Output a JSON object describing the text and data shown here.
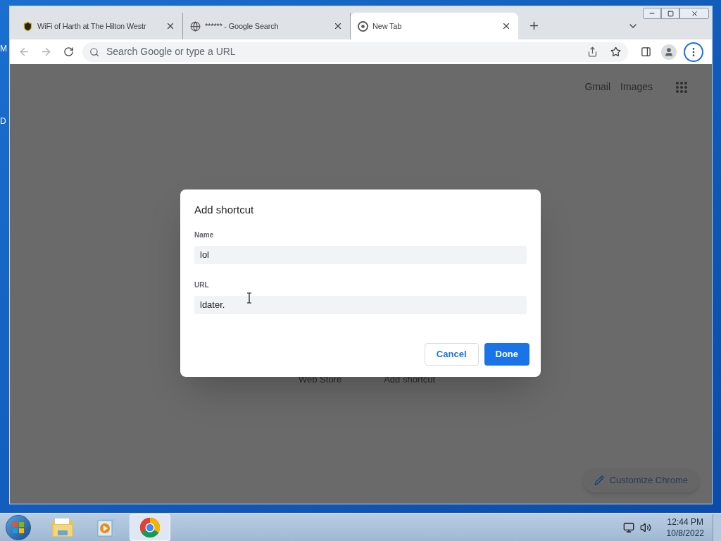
{
  "desktop": {
    "icon_labels": [
      "M",
      "D"
    ]
  },
  "tabs": [
    {
      "title": "WiFi of Harth at The Hilton Westr",
      "kind": "shield",
      "selected": false
    },
    {
      "title": "****** - Google Search",
      "kind": "globe",
      "selected": false
    },
    {
      "title": "New Tab",
      "kind": "chrome",
      "selected": true
    }
  ],
  "address_bar": {
    "placeholder": "Search Google or type a URL"
  },
  "header_links": [
    "Gmail",
    "Images"
  ],
  "shortcut_labels": [
    "Web Store",
    "Add shortcut"
  ],
  "customize_button": "Customize Chrome",
  "dialog": {
    "title": "Add shortcut",
    "fields": [
      {
        "label": "Name",
        "value": "lol"
      },
      {
        "label": "URL",
        "value": "ldater."
      }
    ],
    "buttons": [
      {
        "label": "Cancel",
        "kind": "secondary"
      },
      {
        "label": "Done",
        "kind": "primary"
      }
    ]
  },
  "taskbar": {
    "items": [
      {
        "kind": "folder",
        "selected": false
      },
      {
        "kind": "media",
        "selected": false
      },
      {
        "kind": "chrome",
        "selected": true
      }
    ],
    "time": "12:44 PM",
    "date": "10/8/2022"
  }
}
